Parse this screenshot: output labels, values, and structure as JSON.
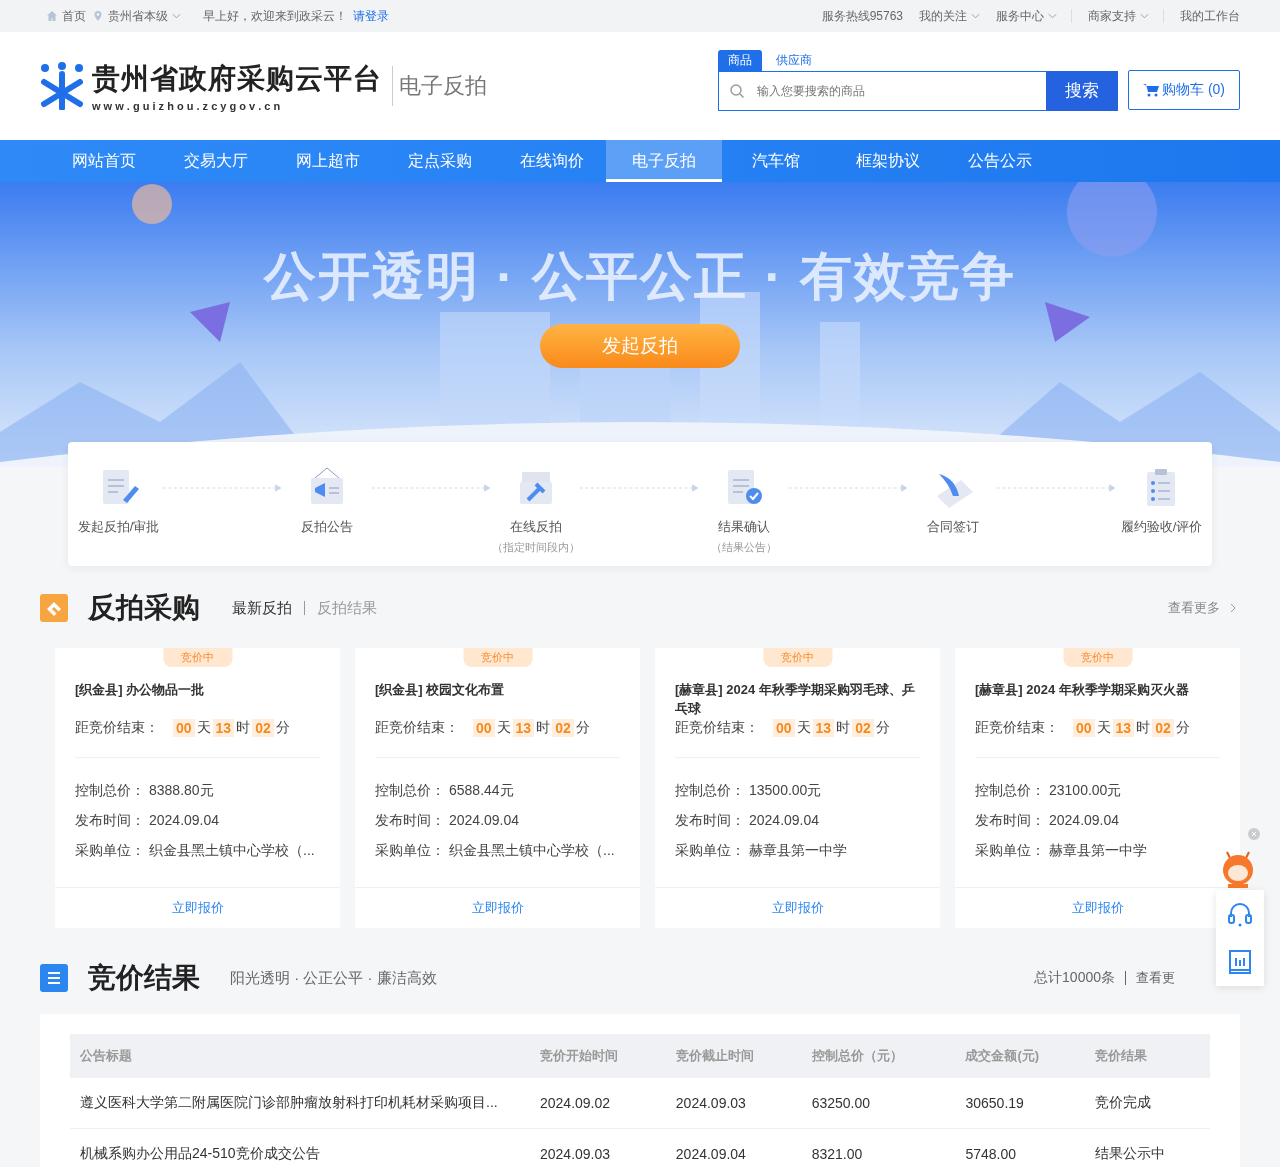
{
  "top_bar": {
    "home": "首页",
    "region": "贵州省本级",
    "greeting": "早上好，欢迎来到政采云！",
    "login": "请登录",
    "links": [
      {
        "label": "服务热线95763",
        "dropdown": false
      },
      {
        "label": "我的关注",
        "dropdown": true
      },
      {
        "label": "服务中心",
        "dropdown": true
      },
      {
        "label": "商家支持",
        "dropdown": true
      },
      {
        "label": "我的工作台",
        "dropdown": false
      }
    ]
  },
  "header": {
    "logo_title": "贵州省政府采购云平台",
    "logo_url": "w w w . g u i z h o u . z c y g o v . c n",
    "subtitle": "电子反拍",
    "search_tabs": [
      {
        "label": "商品",
        "selected": true
      },
      {
        "label": "供应商",
        "selected": false
      }
    ],
    "search_placeholder": "输入您要搜索的商品",
    "search_button": "搜索",
    "cart": "购物车 (0)"
  },
  "nav": [
    {
      "label": "网站首页",
      "selected": false
    },
    {
      "label": "交易大厅",
      "selected": false
    },
    {
      "label": "网上超市",
      "selected": false
    },
    {
      "label": "定点采购",
      "selected": false
    },
    {
      "label": "在线询价",
      "selected": false
    },
    {
      "label": "电子反拍",
      "selected": true
    },
    {
      "label": "汽车馆",
      "selected": false
    },
    {
      "label": "框架协议",
      "selected": false
    },
    {
      "label": "公告公示",
      "selected": false
    }
  ],
  "banner": {
    "kind": "picture",
    "slogan": "公开透明 · 公平公正 · 有效竞争",
    "button": "发起反拍"
  },
  "steps": [
    {
      "label": "发起反拍/审批",
      "kind": "edit"
    },
    {
      "label": "反拍公告",
      "kind": "announce"
    },
    {
      "label": "在线反拍",
      "note": "（指定时间段内）",
      "kind": "auction"
    },
    {
      "label": "结果确认",
      "note": "（结果公告）",
      "kind": "confirm"
    },
    {
      "label": "合同签订",
      "kind": "sign"
    },
    {
      "label": "履约验收/评价",
      "kind": "checklist"
    }
  ],
  "auction_section": {
    "title": "反拍采购",
    "tabs": [
      {
        "label": "最新反拍",
        "selected": true
      },
      {
        "label": "反拍结果",
        "selected": false
      }
    ],
    "more": "查看更多",
    "cards": [
      {
        "badge": "竞价中",
        "title": "[织金县] 办公物品一批",
        "countdown_label": "距竞价结束：",
        "countdown": [
          {
            "value": "00",
            "unit": "天"
          },
          {
            "value": "13",
            "unit": "时"
          },
          {
            "value": "02",
            "unit": "分"
          }
        ],
        "fields": [
          {
            "label": "控制总价：",
            "value": "8388.80元"
          },
          {
            "label": "发布时间：",
            "value": "2024.09.04"
          },
          {
            "label": "采购单位：",
            "value": "织金县黑土镇中心学校（..."
          }
        ],
        "action": "立即报价"
      },
      {
        "badge": "竞价中",
        "title": "[织金县] 校园文化布置",
        "countdown_label": "距竞价结束：",
        "countdown": [
          {
            "value": "00",
            "unit": "天"
          },
          {
            "value": "13",
            "unit": "时"
          },
          {
            "value": "02",
            "unit": "分"
          }
        ],
        "fields": [
          {
            "label": "控制总价：",
            "value": "6588.44元"
          },
          {
            "label": "发布时间：",
            "value": "2024.09.04"
          },
          {
            "label": "采购单位：",
            "value": "织金县黑土镇中心学校（..."
          }
        ],
        "action": "立即报价"
      },
      {
        "badge": "竞价中",
        "title": "[赫章县] 2024 年秋季学期采购羽毛球、乒乓球",
        "countdown_label": "距竞价结束：",
        "countdown": [
          {
            "value": "00",
            "unit": "天"
          },
          {
            "value": "13",
            "unit": "时"
          },
          {
            "value": "02",
            "unit": "分"
          }
        ],
        "fields": [
          {
            "label": "控制总价：",
            "value": "13500.00元"
          },
          {
            "label": "发布时间：",
            "value": "2024.09.04"
          },
          {
            "label": "采购单位：",
            "value": "赫章县第一中学"
          }
        ],
        "action": "立即报价"
      },
      {
        "badge": "竞价中",
        "title": "[赫章县] 2024 年秋季学期采购灭火器",
        "countdown_label": "距竞价结束：",
        "countdown": [
          {
            "value": "00",
            "unit": "天"
          },
          {
            "value": "13",
            "unit": "时"
          },
          {
            "value": "02",
            "unit": "分"
          }
        ],
        "fields": [
          {
            "label": "控制总价：",
            "value": "23100.00元"
          },
          {
            "label": "发布时间：",
            "value": "2024.09.04"
          },
          {
            "label": "采购单位：",
            "value": "赫章县第一中学"
          }
        ],
        "action": "立即报价"
      }
    ]
  },
  "results_section": {
    "title": "竞价结果",
    "subtitle": "阳光透明 · 公正公平 · 廉洁高效",
    "total": "总计10000条",
    "more": "查看更",
    "table": {
      "columns": [
        "公告标题",
        "竞价开始时间",
        "竞价截止时间",
        "控制总价（元）",
        "成交金额(元)",
        "竞价结果"
      ],
      "rows": [
        [
          "遵义医科大学第二附属医院门诊部肿瘤放射科打印机耗材采购项目...",
          "2024.09.02",
          "2024.09.03",
          "63250.00",
          "30650.19",
          "竞价完成"
        ],
        [
          "机械系购办公用品24-510竞价成交公告",
          "2024.09.03",
          "2024.09.04",
          "8321.00",
          "5748.00",
          "结果公示中"
        ]
      ]
    }
  }
}
